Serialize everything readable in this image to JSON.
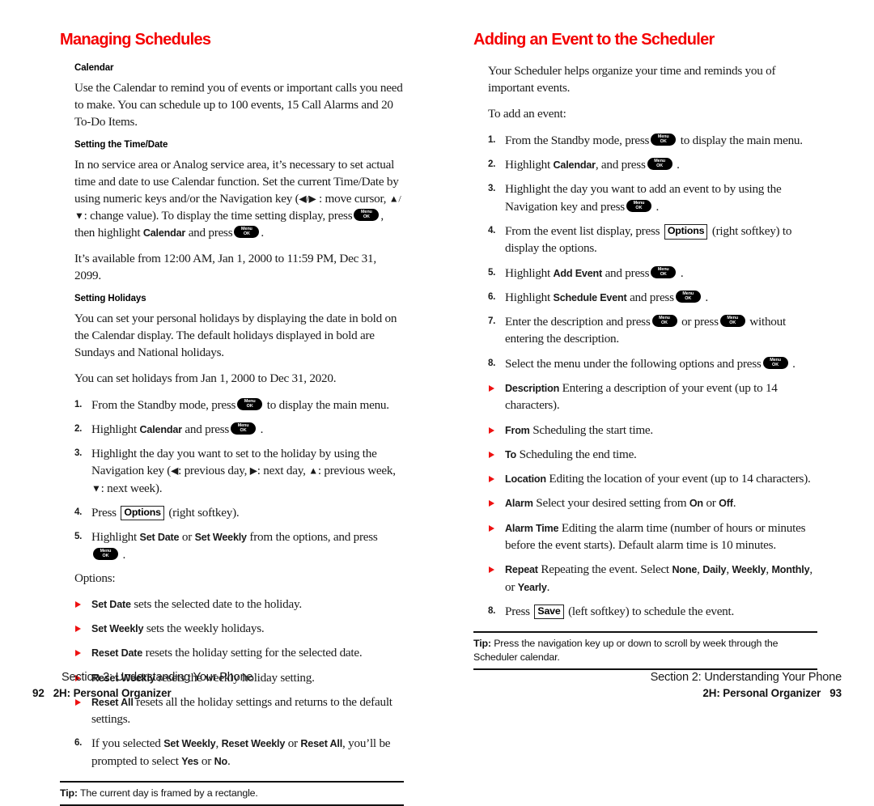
{
  "left_column": {
    "section_title": "Managing Schedules",
    "sub_head_1": "Calendar",
    "para_1": "Use the Calendar to remind you of events or important calls you need to make. You can schedule up to 100 events, 15 Call Alarms and 20 To-Do Items.",
    "sub_head_2": "Setting the Time/Date",
    "para_2_a": "In no service area or Analog service area, it’s necessary to set actual time and date to use Calendar function. Set the current Time/Date by using numeric keys and/or the Navigation key (",
    "nav_lr": "◀/▶",
    "para_2_b": ": move cursor,",
    "nav_ud": "▲/▼",
    "para_2_c": ": change value). To display the time setting display, press",
    "para_2_d": ", then highlight",
    "term_calendar": "Calendar",
    "para_2_e": "and press",
    "para_3": "It’s available from 12:00 AM, Jan 1, 2000 to 11:59 PM, Dec 31, 2099.",
    "sub_head_3": "Setting Holidays",
    "para_4": "You can set your personal holidays by displaying the date in bold on the Calendar display. The default holidays displayed in bold are Sundays and National holidays.",
    "para_5": "You can set holidays from Jan 1, 2000 to Dec 31, 2020.",
    "steps": [
      {
        "num": "1.",
        "a": "From the Standby mode, press",
        "key": "menu-ok",
        "b": "to display the main menu."
      },
      {
        "num": "2.",
        "a": "Highlight",
        "term": "Calendar",
        "b": "and press",
        "key": "menu-ok",
        "c": "."
      },
      {
        "num": "3.",
        "a": "Highlight the day you want to set to the holiday by using the Navigation key (",
        "nav_prev_day": "◀",
        "t1": ": previous day,",
        "nav_next_day": "▶",
        "t2": ": next day,",
        "nav_prev_week": "▲",
        "t3": ": previous week,",
        "nav_next_week": "▼",
        "t4": ": next week)."
      },
      {
        "num": "4.",
        "a": "Press",
        "softkey": "Options",
        "b": "(right softkey)."
      },
      {
        "num": "5.",
        "a": "Highlight",
        "term1": "Set Date",
        "b": "or",
        "term2": "Set Weekly",
        "c": "from the options, and press",
        "key": "menu-ok",
        "d": "."
      }
    ],
    "options_label": "Options:",
    "options": [
      {
        "term": "Set Date",
        "text": "sets the selected date to the holiday."
      },
      {
        "term": "Set Weekly",
        "text": "sets the weekly holidays."
      },
      {
        "term": "Reset Date",
        "text": "resets the holiday setting for the selected date."
      },
      {
        "term": "Reset Weekly",
        "text": "resets the weekly holiday setting."
      },
      {
        "term": "Reset All",
        "text": "resets all the holiday settings and returns to the default settings."
      }
    ],
    "step6": {
      "num": "6.",
      "a": "If you selected",
      "term1": "Set Weekly",
      "b": ",",
      "term2": "Reset Weekly",
      "c": "or",
      "term3": "Reset All",
      "d": ", you’ll be prompted to select",
      "term4": "Yes",
      "e": "or",
      "term5": "No",
      "f": "."
    },
    "tip_label": "Tip:",
    "tip_text": "The current day is framed by a rectangle."
  },
  "right_column": {
    "section_title": "Adding an Event to the Scheduler",
    "para_1": "Your Scheduler helps organize your time and reminds you of important events.",
    "para_2": "To add an event:",
    "steps": [
      {
        "num": "1.",
        "a": "From the Standby mode, press",
        "key": "menu-ok",
        "b": "to display the main menu."
      },
      {
        "num": "2.",
        "a": "Highlight",
        "term": "Calendar",
        "b": ", and press",
        "key": "menu-ok",
        "c": "."
      },
      {
        "num": "3.",
        "a": "Highlight the day you want to add an event to by using the Navigation key and press",
        "key": "menu-ok",
        "b": "."
      },
      {
        "num": "4.",
        "a": "From the event list display, press",
        "softkey": "Options",
        "b": "(right softkey) to display the options."
      },
      {
        "num": "5.",
        "a": "Highlight",
        "term": "Add Event",
        "b": "and press",
        "key": "menu-ok",
        "c": "."
      },
      {
        "num": "6.",
        "a": "Highlight",
        "term": "Schedule Event",
        "b": "and press",
        "key": "menu-ok",
        "c": "."
      },
      {
        "num": "7.",
        "a": "Enter the description and press",
        "key": "menu-ok",
        "b": "or press",
        "key2": "menu-ok",
        "c": "without entering the description."
      },
      {
        "num": "8.",
        "a": "Select the menu under the following options and press",
        "key": "menu-ok",
        "b": "."
      }
    ],
    "options": [
      {
        "term": "Description",
        "text": "Entering a description of your event (up to 14 characters)."
      },
      {
        "term": "From",
        "text": "Scheduling the start time."
      },
      {
        "term": "To",
        "text": "Scheduling the end time."
      },
      {
        "term": "Location",
        "text": "Editing the location of your event (up to 14 characters)."
      },
      {
        "term": "Alarm",
        "text_a": "Select your desired setting from",
        "opt1": "On",
        "text_b": "or",
        "opt2": "Off",
        "text_c": "."
      },
      {
        "term": "Alarm Time",
        "text": "Editing the alarm time (number of hours or minutes before the event starts). Default alarm time is 10 minutes."
      },
      {
        "term": "Repeat",
        "text_a": "Repeating the event. Select",
        "opt1": "None",
        "sep1": ",",
        "opt2": "Daily",
        "sep2": ",",
        "opt3": "Weekly",
        "sep3": ",",
        "opt4": "Monthly",
        "text_b": ", or",
        "opt5": "Yearly",
        "text_c": "."
      }
    ],
    "step8_final": {
      "num": "8.",
      "a": "Press",
      "softkey": "Save",
      "b": "(left softkey) to schedule the event."
    },
    "tip_label": "Tip:",
    "tip_text": "Press the navigation key up or down to scroll by week through the Scheduler calendar."
  },
  "footer_left": {
    "section": "Section 2: Understanding Your Phone",
    "chapter": "2H: Personal Organizer",
    "page": "92"
  },
  "footer_right": {
    "section": "Section 2: Understanding Your Phone",
    "chapter": "2H: Personal Organizer",
    "page": "93"
  },
  "keys": {
    "menu_line1": "Menu",
    "menu_line2": "OK"
  },
  "colors": {
    "heading_red": "#f40000",
    "bullet_red": "#ee1111",
    "text": "#1a1a1a"
  }
}
